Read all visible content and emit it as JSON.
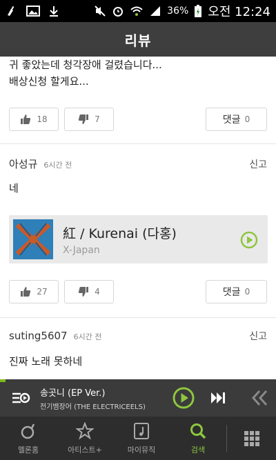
{
  "status_bar": {
    "battery": "36%",
    "time": "오전 12:24"
  },
  "header": {
    "title": "리뷰"
  },
  "reviews": [
    {
      "body_lines": [
        "귀 좋았는데 청각장애 걸렸습니다...",
        "배상신청 할게요..."
      ],
      "likes": "18",
      "dislikes": "7",
      "comment_label": "댓글",
      "comment_count": "0"
    },
    {
      "author": "아성규",
      "ago": "6시간 전",
      "report": "신고",
      "body": "네",
      "song": {
        "title": "紅 / Kurenai (다홍)",
        "artist": "X-Japan"
      },
      "likes": "27",
      "dislikes": "4",
      "comment_label": "댓글",
      "comment_count": "0"
    },
    {
      "author": "suting5607",
      "ago": "6시간 전",
      "report": "신고",
      "body": "진짜 노래 못하네"
    }
  ],
  "player": {
    "title": "송곳니 (EP Ver.)",
    "artist": "전기뱀장어 (THE ELECTRICEELS)"
  },
  "tabs": [
    {
      "label": "멜론홈",
      "icon": "melon-icon",
      "active": false
    },
    {
      "label": "아티스트+",
      "icon": "star-icon",
      "active": false
    },
    {
      "label": "마이뮤직",
      "icon": "music-note-icon",
      "active": false
    },
    {
      "label": "검색",
      "icon": "search-icon",
      "active": true
    }
  ],
  "colors": {
    "accent": "#8dc63f",
    "header": "#3e3e3e",
    "player": "#3b3b3b",
    "tabbar": "#2d2d2d"
  }
}
